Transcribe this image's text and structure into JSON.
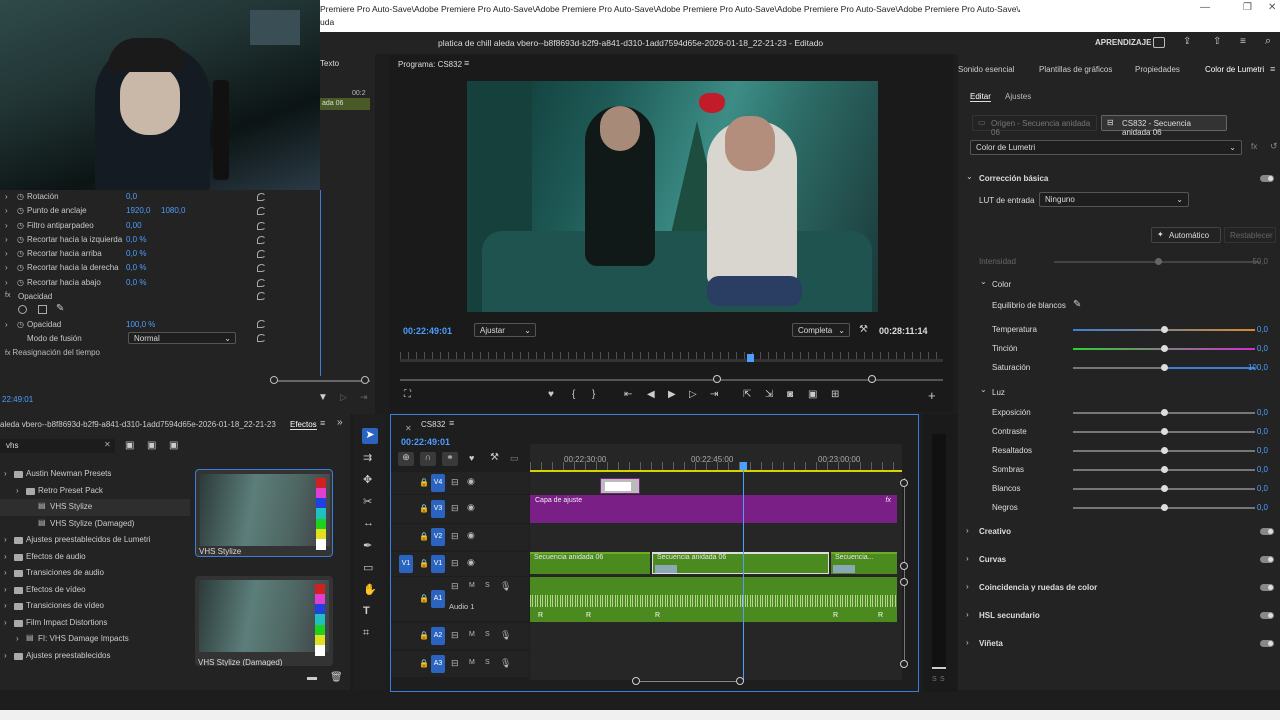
{
  "titlebar": {
    "text": "Premiere Pro Auto-Save\\Adobe Premiere Pro Auto-Save\\Adobe Premiere Pro Auto-Save\\Adobe Premiere Pro Auto-Save\\Adobe Premiere Pro Auto-Save\\Adobe Premiere Pro Auto-Save\\Adobe Premiere Pro Auto-Save\\Adobe Premiere Pro Auto-Save\\Adobe",
    "text2": "uda"
  },
  "header": {
    "file_title": "platica de chill aleda vbero--b8f8693d-b2f9-a841-d310-1add7594d65e-2026-01-18_22-21-23 - Editado",
    "learn": "APRENDIZAJE"
  },
  "source_tab": {
    "label": "Texto",
    "timecode": "00:2",
    "clip": "ada 06"
  },
  "effect_controls": {
    "rows": [
      {
        "label": "Rotación",
        "values": [
          "0,0"
        ]
      },
      {
        "label": "Punto de anclaje",
        "values": [
          "1920,0",
          "1080,0"
        ]
      },
      {
        "label": "Filtro antiparpadeo",
        "values": [
          "0,00"
        ]
      },
      {
        "label": "Recortar hacia la izquierda",
        "values": [
          "0,0 %"
        ]
      },
      {
        "label": "Recortar hacia arriba",
        "values": [
          "0,0 %"
        ]
      },
      {
        "label": "Recortar hacia la derecha",
        "values": [
          "0,0 %"
        ]
      },
      {
        "label": "Recortar hacia abajo",
        "values": [
          "0,0 %"
        ]
      }
    ],
    "opacity_section": "Opacidad",
    "opacity_label": "Opacidad",
    "opacity_value": "100,0 %",
    "blend_label": "Modo de fusión",
    "blend_value": "Normal",
    "time_remap": "Reasignación del tiempo",
    "timecode": "22:49:01"
  },
  "program": {
    "title": "Programa: CS832",
    "timecode": "00:22:49:01",
    "fit": "Ajustar",
    "quality": "Completa",
    "duration": "00:28:11:14",
    "playhead_fraction": 0.645
  },
  "lumetri": {
    "tabs": [
      "Sonido esencial",
      "Plantillas de gráficos",
      "Propiedades",
      "Color de Lumetri"
    ],
    "subtabs": [
      "Editar",
      "Ajustes"
    ],
    "source_btn": "Origen - Secuencia anidada 06",
    "seq_btn": "CS832 - Secuencia anidada 06",
    "effect_dropdown": "Color de Lumetri",
    "basic": "Corrección básica",
    "lut_label": "LUT de entrada",
    "lut_value": "Ninguno",
    "auto": "Automático",
    "reset": "Restablecer",
    "intensity_label": "Intensidad",
    "intensity_value": "50,0",
    "color_section": "Color",
    "white_balance": "Equilibrio de blancos",
    "color_sliders": [
      {
        "label": "Temperatura",
        "value": "0,0",
        "pos": 0.5
      },
      {
        "label": "Tinción",
        "value": "0,0",
        "pos": 0.5
      },
      {
        "label": "Saturación",
        "value": "100,0",
        "pos": 0.5
      }
    ],
    "light_section": "Luz",
    "light_sliders": [
      {
        "label": "Exposición",
        "value": "0,0",
        "pos": 0.5
      },
      {
        "label": "Contraste",
        "value": "0,0",
        "pos": 0.5
      },
      {
        "label": "Resaltados",
        "value": "0,0",
        "pos": 0.5
      },
      {
        "label": "Sombras",
        "value": "0,0",
        "pos": 0.5
      },
      {
        "label": "Blancos",
        "value": "0,0",
        "pos": 0.5
      },
      {
        "label": "Negros",
        "value": "0,0",
        "pos": 0.5
      }
    ],
    "sections": [
      "Creativo",
      "Curvas",
      "Coincidencia y ruedas de color",
      "HSL secundario",
      "Viñeta"
    ]
  },
  "project": {
    "title": "aleda vbero--b8f8693d-b2f9-a841-d310-1add7594d65e-2026-01-18_22-21-23",
    "effects_tab": "Efectos",
    "search_value": "vhs",
    "items": [
      {
        "label": "Austin Newman Presets",
        "indent": 0
      },
      {
        "label": "Retro Preset Pack",
        "indent": 1
      },
      {
        "label": "VHS Stylize",
        "indent": 2
      },
      {
        "label": "VHS Stylize (Damaged)",
        "indent": 2
      },
      {
        "label": "Ajustes preestablecidos de Lumetri",
        "indent": 0
      },
      {
        "label": "Efectos de audio",
        "indent": 0
      },
      {
        "label": "Transiciones de audio",
        "indent": 0
      },
      {
        "label": "Efectos de vídeo",
        "indent": 0
      },
      {
        "label": "Transiciones de vídeo",
        "indent": 0
      },
      {
        "label": "Film Impact Distortions",
        "indent": 0
      },
      {
        "label": "FI: VHS Damage Impacts",
        "indent": 1
      },
      {
        "label": "Ajustes preestablecidos",
        "indent": 0
      }
    ],
    "thumb1": "VHS Stylize",
    "thumb2": "VHS Stylize (Damaged)"
  },
  "timeline": {
    "title": "CS832",
    "timecode": "00:22:49:01",
    "ruler": [
      "00:22:30:00",
      "00:22:45:00",
      "00:23:00:00"
    ],
    "tracks": [
      "V4",
      "V3",
      "V2",
      "V1",
      "A1",
      "A2",
      "A3"
    ],
    "v1_source": "V1",
    "audio_name": "Audio 1",
    "adjust_clip": "Capa de ajuste",
    "clips": [
      "Secuencia anidada 06",
      "Secuencia anidada 06",
      "Secuencia..."
    ],
    "mute": "M",
    "solo": "S",
    "fx": "fx",
    "r": "R"
  }
}
